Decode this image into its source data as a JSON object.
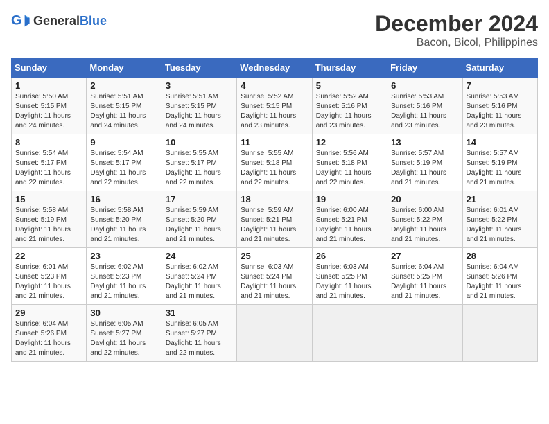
{
  "logo": {
    "general": "General",
    "blue": "Blue"
  },
  "title": "December 2024",
  "subtitle": "Bacon, Bicol, Philippines",
  "weekdays": [
    "Sunday",
    "Monday",
    "Tuesday",
    "Wednesday",
    "Thursday",
    "Friday",
    "Saturday"
  ],
  "weeks": [
    [
      {
        "day": "1",
        "sunrise": "5:50 AM",
        "sunset": "5:15 PM",
        "daylight": "11 hours and 24 minutes."
      },
      {
        "day": "2",
        "sunrise": "5:51 AM",
        "sunset": "5:15 PM",
        "daylight": "11 hours and 24 minutes."
      },
      {
        "day": "3",
        "sunrise": "5:51 AM",
        "sunset": "5:15 PM",
        "daylight": "11 hours and 24 minutes."
      },
      {
        "day": "4",
        "sunrise": "5:52 AM",
        "sunset": "5:15 PM",
        "daylight": "11 hours and 23 minutes."
      },
      {
        "day": "5",
        "sunrise": "5:52 AM",
        "sunset": "5:16 PM",
        "daylight": "11 hours and 23 minutes."
      },
      {
        "day": "6",
        "sunrise": "5:53 AM",
        "sunset": "5:16 PM",
        "daylight": "11 hours and 23 minutes."
      },
      {
        "day": "7",
        "sunrise": "5:53 AM",
        "sunset": "5:16 PM",
        "daylight": "11 hours and 23 minutes."
      }
    ],
    [
      {
        "day": "8",
        "sunrise": "5:54 AM",
        "sunset": "5:17 PM",
        "daylight": "11 hours and 22 minutes."
      },
      {
        "day": "9",
        "sunrise": "5:54 AM",
        "sunset": "5:17 PM",
        "daylight": "11 hours and 22 minutes."
      },
      {
        "day": "10",
        "sunrise": "5:55 AM",
        "sunset": "5:17 PM",
        "daylight": "11 hours and 22 minutes."
      },
      {
        "day": "11",
        "sunrise": "5:55 AM",
        "sunset": "5:18 PM",
        "daylight": "11 hours and 22 minutes."
      },
      {
        "day": "12",
        "sunrise": "5:56 AM",
        "sunset": "5:18 PM",
        "daylight": "11 hours and 22 minutes."
      },
      {
        "day": "13",
        "sunrise": "5:57 AM",
        "sunset": "5:19 PM",
        "daylight": "11 hours and 21 minutes."
      },
      {
        "day": "14",
        "sunrise": "5:57 AM",
        "sunset": "5:19 PM",
        "daylight": "11 hours and 21 minutes."
      }
    ],
    [
      {
        "day": "15",
        "sunrise": "5:58 AM",
        "sunset": "5:19 PM",
        "daylight": "11 hours and 21 minutes."
      },
      {
        "day": "16",
        "sunrise": "5:58 AM",
        "sunset": "5:20 PM",
        "daylight": "11 hours and 21 minutes."
      },
      {
        "day": "17",
        "sunrise": "5:59 AM",
        "sunset": "5:20 PM",
        "daylight": "11 hours and 21 minutes."
      },
      {
        "day": "18",
        "sunrise": "5:59 AM",
        "sunset": "5:21 PM",
        "daylight": "11 hours and 21 minutes."
      },
      {
        "day": "19",
        "sunrise": "6:00 AM",
        "sunset": "5:21 PM",
        "daylight": "11 hours and 21 minutes."
      },
      {
        "day": "20",
        "sunrise": "6:00 AM",
        "sunset": "5:22 PM",
        "daylight": "11 hours and 21 minutes."
      },
      {
        "day": "21",
        "sunrise": "6:01 AM",
        "sunset": "5:22 PM",
        "daylight": "11 hours and 21 minutes."
      }
    ],
    [
      {
        "day": "22",
        "sunrise": "6:01 AM",
        "sunset": "5:23 PM",
        "daylight": "11 hours and 21 minutes."
      },
      {
        "day": "23",
        "sunrise": "6:02 AM",
        "sunset": "5:23 PM",
        "daylight": "11 hours and 21 minutes."
      },
      {
        "day": "24",
        "sunrise": "6:02 AM",
        "sunset": "5:24 PM",
        "daylight": "11 hours and 21 minutes."
      },
      {
        "day": "25",
        "sunrise": "6:03 AM",
        "sunset": "5:24 PM",
        "daylight": "11 hours and 21 minutes."
      },
      {
        "day": "26",
        "sunrise": "6:03 AM",
        "sunset": "5:25 PM",
        "daylight": "11 hours and 21 minutes."
      },
      {
        "day": "27",
        "sunrise": "6:04 AM",
        "sunset": "5:25 PM",
        "daylight": "11 hours and 21 minutes."
      },
      {
        "day": "28",
        "sunrise": "6:04 AM",
        "sunset": "5:26 PM",
        "daylight": "11 hours and 21 minutes."
      }
    ],
    [
      {
        "day": "29",
        "sunrise": "6:04 AM",
        "sunset": "5:26 PM",
        "daylight": "11 hours and 21 minutes."
      },
      {
        "day": "30",
        "sunrise": "6:05 AM",
        "sunset": "5:27 PM",
        "daylight": "11 hours and 22 minutes."
      },
      {
        "day": "31",
        "sunrise": "6:05 AM",
        "sunset": "5:27 PM",
        "daylight": "11 hours and 22 minutes."
      },
      null,
      null,
      null,
      null
    ]
  ]
}
